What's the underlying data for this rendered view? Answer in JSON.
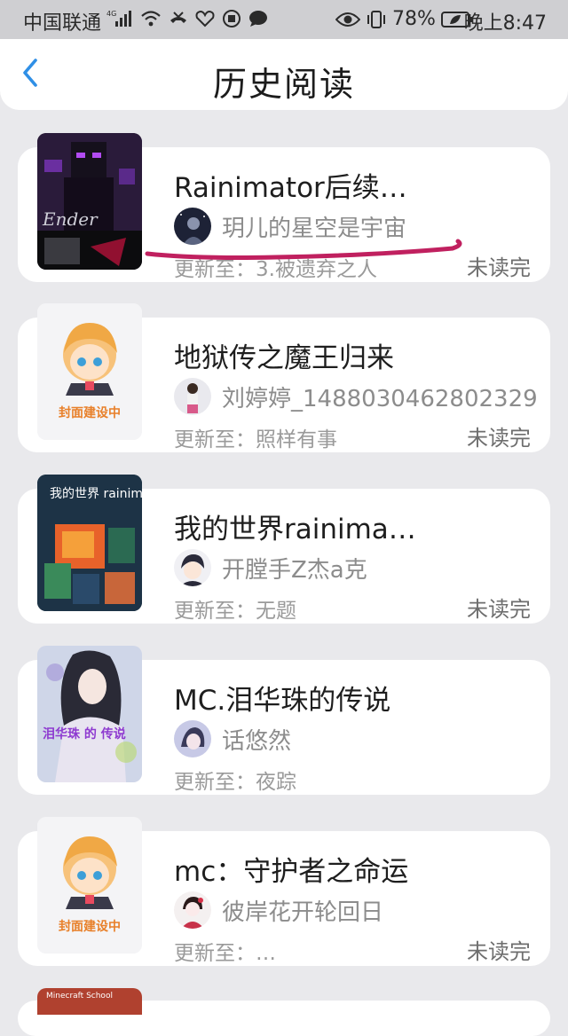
{
  "status_bar": {
    "carrier": "中国联通",
    "network": "4G",
    "battery": "78%",
    "time": "晚上8:47"
  },
  "header": {
    "title": "历史阅读",
    "back_icon": "chevron-left-icon"
  },
  "books": [
    {
      "title": "Rainimator后续…",
      "author": "玥儿的星空是宇宙",
      "update": "更新至：3.被遗弃之人",
      "status": "未读完",
      "cover_text": "Ender"
    },
    {
      "title": "地狱传之魔王归来",
      "author": "刘婷婷_1488030462802329",
      "update": "更新至：照样有事",
      "status": "未读完",
      "cover_text": "封面建设中"
    },
    {
      "title": "我的世界rainima…",
      "author": "开膛手Z杰a克",
      "update": "更新至：无题",
      "status": "未读完",
      "cover_text": "我的世界 rainimator"
    },
    {
      "title": "MC.泪华珠的传说",
      "author": "话悠然",
      "update": "更新至：夜踪",
      "status": "",
      "cover_text": "泪华珠 的 传说"
    },
    {
      "title": "mc：守护者之命运",
      "author": "彼岸花开轮回日",
      "update": "更新至：…",
      "status": "未读完",
      "cover_text": "封面建设中"
    }
  ],
  "peek_cover_text": "Minecraft School",
  "colors": {
    "accent": "#2f8fe6",
    "annotation": "#c0205f",
    "placeholder_text": "#e8802a"
  }
}
